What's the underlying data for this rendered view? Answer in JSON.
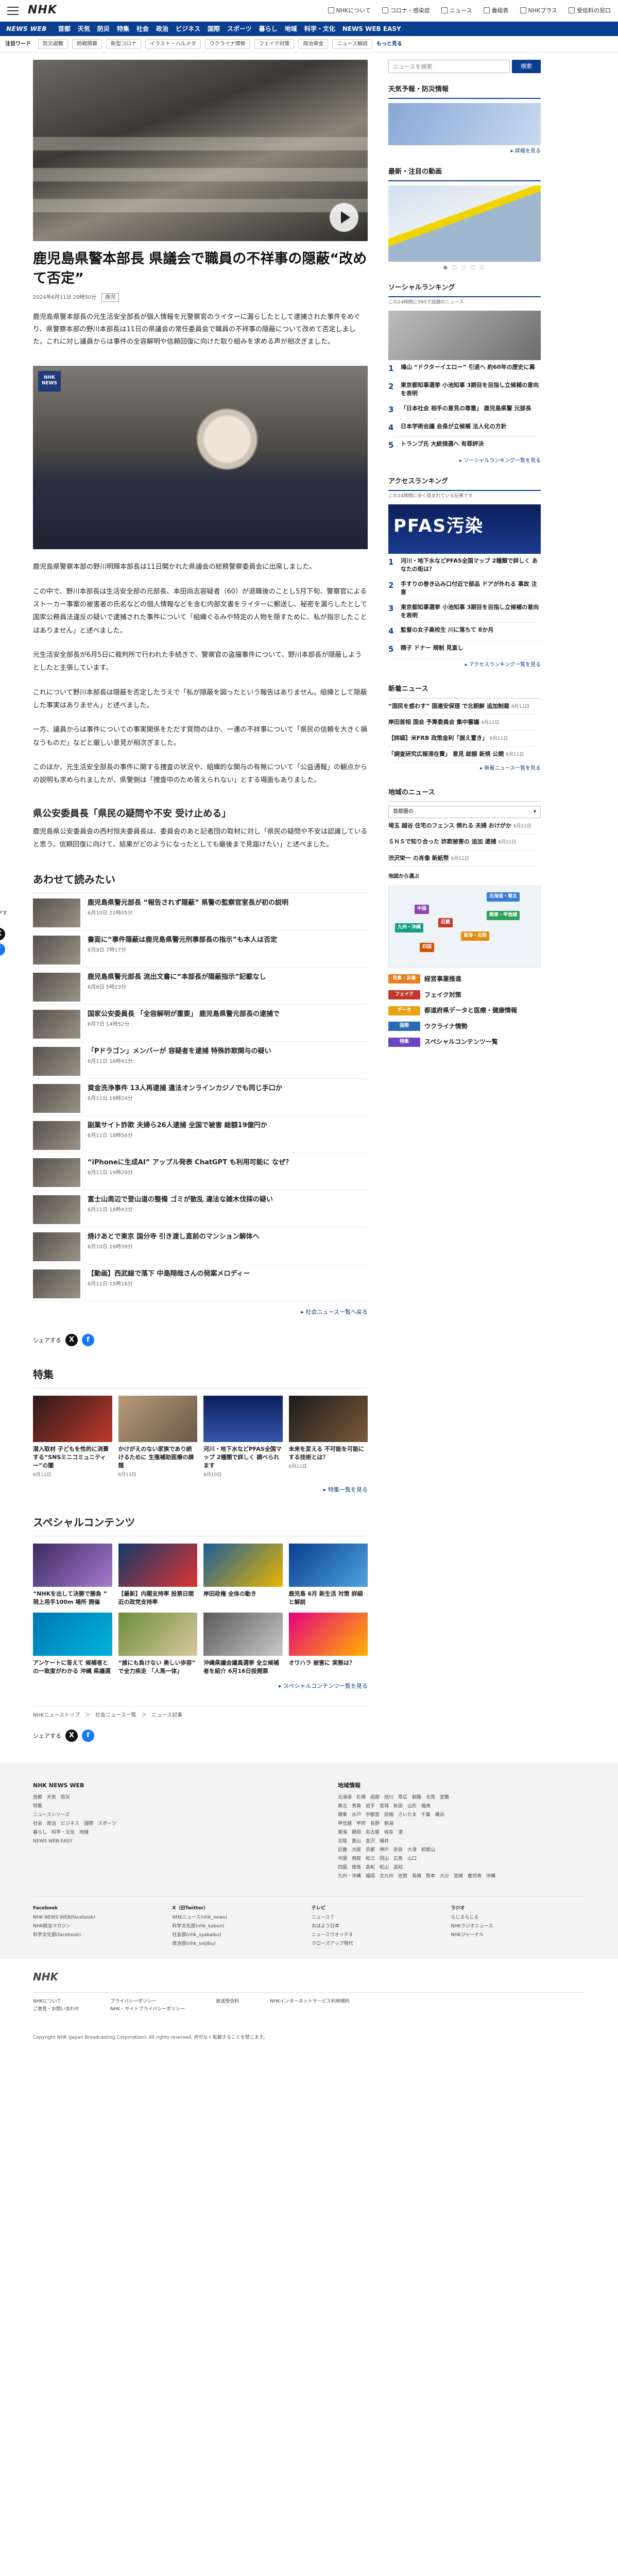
{
  "header": {
    "logo": "NHK",
    "links": [
      "NHKについて",
      "コロナ・感染症",
      "ニュース",
      "番組表",
      "NHKプラス",
      "受信料の窓口"
    ]
  },
  "nav": {
    "brand": "NEWS WEB",
    "items": [
      "首都",
      "天気",
      "防災",
      "特集",
      "社会",
      "政治",
      "ビジネス",
      "国際",
      "スポーツ",
      "暮らし",
      "地域",
      "科学・文化",
      "NEWS WEB EASY"
    ]
  },
  "keywords": {
    "label": "注目ワード",
    "items": [
      "防災避難",
      "熱戦開幕",
      "新型コロナ",
      "イラスト・ハルメタ",
      "ウクライナ情勢",
      "フェイク対策",
      "政治資金",
      "ニュース解説"
    ],
    "more": "もっと見る"
  },
  "article": {
    "title": "鹿児島県警本部長 県議会で職員の不祥事の隠蔽“改めて否定”",
    "date": "2024年6月11日 20時50分",
    "badge": "鹿児",
    "lead": "鹿児島県警本部長の元生活安全部長が個人情報を元警察官のライターに漏らしたとして逮捕された事件をめぐり、県警察本部の野川本部長は11日の県議会の常任委員会で職員の不祥事の隠蔽について改めて否定しました。これに対し議員からは事件の全容解明や信頼回復に向けた取り組みを求める声が相次ぎました。",
    "photo2_mark": "NHK NEWS",
    "caption": "鹿児島県警察本部の野川明輝本部長は11日開かれた県議会の総務警察委員会に出席しました。",
    "paras": [
      "この中で、野川本部長は生活安全部の元部長、本田尚志容疑者（60）が退職後のことし5月下旬、警察官によるストーカー事案の被害者の氏名などの個人情報などを含む内部文書をライターに郵送し、秘密を漏らしたとして国家公務員法違反の疑いで逮捕された事件について「組織ぐるみや特定の人物を隠すために、私が指示したことはありません」と述べました。",
      "元生活安全部長が6月5日に裁判所で行われた手続きで、警察官の盗撮事件について、野川本部長が隠蔽しようとしたと主張しています。",
      "これについて野川本部長は隠蔽を否定したうえで「私が隠蔽を図ったという報告はありません。組織として隠蔽した事実はありません」と述べました。",
      "一方、議員からは事件についての事実関係をただす質問のほか、一連の不祥事について「県民の信頼を大きく損なうものだ」などと厳しい意見が相次ぎました。",
      "このほか、元生活安全部長の事件に関する捜査の状況や、組織的な関与の有無について「公益通報」の観点からの説明も求められましたが、県警側は「捜査中のため答えられない」とする場面もありました。"
    ],
    "sub_heading": "県公安委員長「県民の疑問や不安 受け止める」",
    "sub_para": "鹿児島県公安委員会の西村恒夫委員長は、委員会のあと記者団の取材に対し「県民の疑問や不安は認識していると思う。信頼回復に向けて、結果がどのようになったとしても最後まで見届けたい」と述べました。"
  },
  "related": {
    "title": "あわせて読みたい",
    "items": [
      {
        "t": "鹿児島県警元部長 “報告されず隠蔽” 県警の監察官室長が初の説明",
        "d": "6月10日 22時05分"
      },
      {
        "t": "書面に“事件隠蔽は鹿児島県警元刑事部長の指示”も本人は否定",
        "d": "6月9日 7時17分"
      },
      {
        "t": "鹿児島県警元部長 流出文書に“本部長が隠蔽指示”記載なし",
        "d": "6月8日 5時23分"
      },
      {
        "t": "国家公安委員長 「全容解明が重要」 鹿児島県警元部長の逮捕で",
        "d": "6月7日 14時52分"
      },
      {
        "t": "「Pドラゴン」メンバーが 容疑者を逮捕 特殊詐欺関与の疑い",
        "d": "6月11日 16時41分"
      },
      {
        "t": "資金洗浄事件 13人再逮捕 違法オンラインカジノでも同じ手口か",
        "d": "6月11日 18時24分"
      },
      {
        "t": "副業サイト詐欺 夫婦ら26人逮捕 全国で被害 総額19億円か",
        "d": "6月11日 18時56分"
      },
      {
        "t": "“iPhoneに生成AI” アップル発表 ChatGPT も利用可能に なぜ？",
        "d": "6月11日 19時29分"
      },
      {
        "t": "富士山周辺で登山道の整備 ゴミが散乱 違法な雑木伐採の疑い",
        "d": "6月11日 18時43分"
      },
      {
        "t": "焼けあとで東京 国分寺 引き渡し直前のマンション解体へ",
        "d": "6月10日 16時39分"
      },
      {
        "t": "【動画】西武線で落下 中島翔哉さんの発案メロディー",
        "d": "6月11日 15時16分"
      }
    ],
    "more": "社会ニュース一覧へ戻る"
  },
  "share_label": "シェアする",
  "special": {
    "title": "特集",
    "items": [
      {
        "t": "潜入取材 子どもを性的に消費する“SNSミニコミュニティー”の闇",
        "d": "6月11日"
      },
      {
        "t": "かけがえのない家族であり続けるために 生殖補助医療の課題",
        "d": "6月11日"
      },
      {
        "t": "河川・地下水などPFAS全国マップ 2種類で詳しく 調べられます",
        "d": "6月10日"
      },
      {
        "t": "未来を変える 不可能を可能にする技術とは？",
        "d": "6月11日"
      }
    ],
    "more": "特集一覧を見る"
  },
  "contents": {
    "title": "スペシャルコンテンツ",
    "items": [
      {
        "t": "“NHKを出して決勝で勝負 ” 現上用手100m 場所 開催"
      },
      {
        "t": "【最新】内閣支持率 投票日間近の政党支持率"
      },
      {
        "t": "岸田政権 全体の動き"
      },
      {
        "t": "鹿児島 6月 新生活 対策 詳細と解説"
      },
      {
        "t": "アンケートに答えて 候補者との一致度がわかる 沖縄 県議選"
      },
      {
        "t": "“誰にも負けない 美しい歩容” で全力疾走 「人馬一体」"
      },
      {
        "t": "沖縄県議会議員選挙 全立候補者を紹介 6月16日投開票"
      },
      {
        "t": "オワハラ 被害に 実態は？"
      }
    ],
    "more": "スペシャルコンテンツ一覧を見る"
  },
  "breadcrumb": "NHKニューストップ　＞　社会ニュース一覧　＞　ニュース記事",
  "sidebar": {
    "search_placeholder": "ニュースを検索",
    "search_button": "検索",
    "weather_title": "天気予報・防災情報",
    "weather_more": "詳細を見る",
    "latest_title": "最新・注目の動画",
    "ranking_title": "ソーシャルランキング",
    "ranking_note": "この24時間にSNSで話題のニュース",
    "ranking": [
      "鳩山 “ドクターイエロー” 引退へ 約60年の歴史に幕",
      "東京都知事選挙 小池知事 3期目を目指し立候補の意向を表明",
      "「日本社会 相手の意見の尊重」 鹿児島県警 元部長",
      "日本学術会議 会長が立候補 法人化の方針",
      "トランプ氏 大統領選へ 有罪評決",
      "ソーシャルランキング一覧を見る"
    ],
    "access_title": "アクセスランキング",
    "access_note": "この24時間に多く読まれている記事です",
    "pfas_banner": "PFAS汚染",
    "access": [
      "河川・地下水などPFAS全国マップ 2種類で詳しく あなたの街は？",
      "手すりの巻き込み口付近で部品 ドアが外れる 事故 注意",
      "東京都知事選挙 小池知事 3期目を目指し立候補の意向を表明",
      "監督の女子高校生 川に落ちて 8か月",
      "精子 ドナー 規制 見直し",
      "アクセスランキング一覧を見る"
    ],
    "new_title": "新着ニュース",
    "new": [
      {
        "t": "“国民を惑わす” 国連安保理 で北朝鮮 追加制裁",
        "d": "6月11日"
      },
      {
        "t": "岸田首相 国会 予算委員会 集中審議",
        "d": "6月11日"
      },
      {
        "t": "【詳細】米FRB 政策金利「据え置き」",
        "d": "6月11日"
      },
      {
        "t": "「調査研究広報滞在費」 意見 総額 新規 公開",
        "d": "6月11日"
      },
      {
        "t": "新着ニュース一覧を見る",
        "d": ""
      }
    ],
    "local_title": "地域のニュース",
    "local_select": "首都圏の",
    "local": [
      {
        "t": "埼玉 越谷 住宅のフェンス 倒れる 夫婦 おけがか",
        "d": "6月11日"
      },
      {
        "t": "ＳＮＳで知り合った 詐欺被害の 追加 逮捕",
        "d": "6月11日"
      },
      {
        "t": "渋沢栄一 の肖像 新紙幣",
        "d": "6月11日"
      }
    ],
    "map_title": "地図から選ぶ",
    "map_regions": [
      "北海道・東北",
      "関東・甲信越",
      "東海・北陸",
      "近畿",
      "中国",
      "九州・沖縄",
      "四国"
    ],
    "features": [
      {
        "tag": "気象・災害",
        "t": "経営事業推進"
      },
      {
        "tag": "フェイク",
        "t": "フェイク対策"
      },
      {
        "tag": "データ",
        "t": "都道府県データと医療・健康情報"
      },
      {
        "tag": "国際",
        "t": "ウクライナ情勢"
      },
      {
        "tag": "特集",
        "t": "スペシャルコンテンツ一覧"
      }
    ]
  },
  "footer": {
    "col1_title": "NHK NEWS WEB",
    "col1": "首都　天気　防災\n特集\nニュースシリーズ\n社会　政治　ビジネス　国際　スポーツ\n暮らし　科学・文化　地域\nNEWS WEB EASY",
    "col2_title": "地域情報",
    "col2": "北海道　札幌　函館　旭川　帯広　釧路　北見　室蘭\n東北　青森　岩手　宮城　秋田　山形　福島\n関東　水戸　宇都宮　前橋　さいたま　千葉　横浜\n甲信越　甲府　長野　新潟\n東海　静岡　名古屋　岐阜　津\n北陸　富山　金沢　福井\n近畿　大阪　京都　神戸　奈良　大津　和歌山\n中国　鳥取　松江　岡山　広島　山口\n四国　徳島　高松　松山　高知\n九州・沖縄　福岡　北九州　佐賀　長崎　熊本　大分　宮崎　鹿児島　沖縄",
    "grid": [
      {
        "h": "Facebook",
        "l": "NHK NEWS WEB(facebook)\nNHK政治マガジン\n科学文化部(facebook)"
      },
      {
        "h": "X（旧Twitter）",
        "l": "NHKニュース(nhk_news)\n科学文化部(nhk_kabun)\n社会部(nhk_syakaibu)\n政治部(nhk_seijibu)"
      },
      {
        "h": "テレビ",
        "l": "ニュース７\nおはよう日本\nニュースウオッチ９\nクローズアップ現代"
      },
      {
        "h": "ラジオ",
        "l": "らじるらじる\nNHKラジオニュース\nNHKジャーナル"
      }
    ],
    "logo": "NHK",
    "bottom_links": [
      "NHKについて\nご意見・お問い合わせ",
      "プライバシーポリシー\nNHK・サイトプライバシーポリシー",
      "放送受信料",
      "NHKインターネットサービス利用規約"
    ],
    "copyright": "Copyright NHK (Japan Broadcasting Corporation). All rights reserved. 許可なく転載することを禁じます。"
  }
}
